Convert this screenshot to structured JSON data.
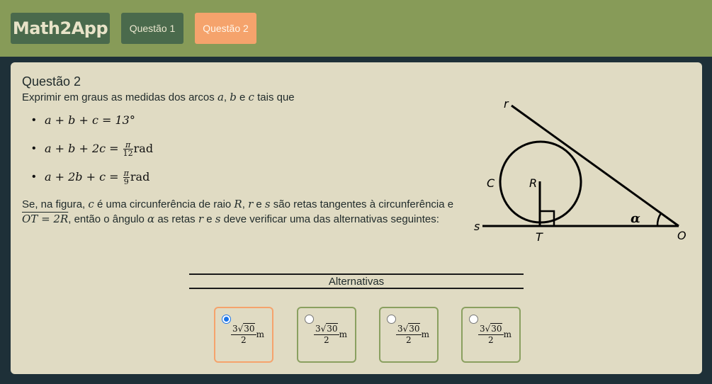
{
  "app": {
    "logo": "Math2App"
  },
  "nav": {
    "q1": "Questão 1",
    "q2": "Questão 2"
  },
  "question": {
    "title": "Questão 2",
    "prompt_pre": "Exprimir em graus as medidas dos arcos ",
    "prompt_a": "a",
    "prompt_sep": ", ",
    "prompt_b": "b",
    "prompt_and": " e ",
    "prompt_c": "c",
    "prompt_post": " tais que",
    "equations": [
      {
        "lhs": "a + b + c = 13°"
      },
      {
        "lhs": "a + b + 2c = ",
        "num": "π",
        "den": "12",
        "unit": "rad"
      },
      {
        "lhs": "a + 2b + c = ",
        "num": "π",
        "den": "9",
        "unit": "rad"
      }
    ],
    "para": {
      "t1": "Se, na figura, ",
      "c": "c",
      "t2": " é uma circunferência de raio ",
      "R": "R",
      "t3": ", ",
      "r": "r",
      "t4": " e ",
      "s": "s",
      "t5": " são retas tangentes à circunferência e ",
      "OT": "OT = 2R",
      "t6": ", então o ângulo ",
      "alpha": "α",
      "t7": " as retas ",
      "r2": "r",
      "t8": " e ",
      "s2": "s",
      "t9": " deve verificar uma das alternativas seguintes:"
    }
  },
  "figure_labels": {
    "r": "r",
    "C": "C",
    "R": "R",
    "s": "s",
    "T": "T",
    "alpha": "α",
    "O": "O"
  },
  "alternatives": {
    "header": "Alternativas",
    "selected_index": 0,
    "options": [
      {
        "coef": "3",
        "root": "30",
        "den": "2",
        "unit": "m"
      },
      {
        "coef": "3",
        "root": "30",
        "den": "2",
        "unit": "m"
      },
      {
        "coef": "3",
        "root": "30",
        "den": "2",
        "unit": "m"
      },
      {
        "coef": "3",
        "root": "30",
        "den": "2",
        "unit": "m"
      }
    ]
  },
  "colors": {
    "topbar": "#879b58",
    "nav_dark": "#4a6a4c",
    "nav_active": "#f5a36c",
    "panel": "#e0dbc3",
    "background": "#1e3038",
    "option_border": "#8aa060"
  }
}
